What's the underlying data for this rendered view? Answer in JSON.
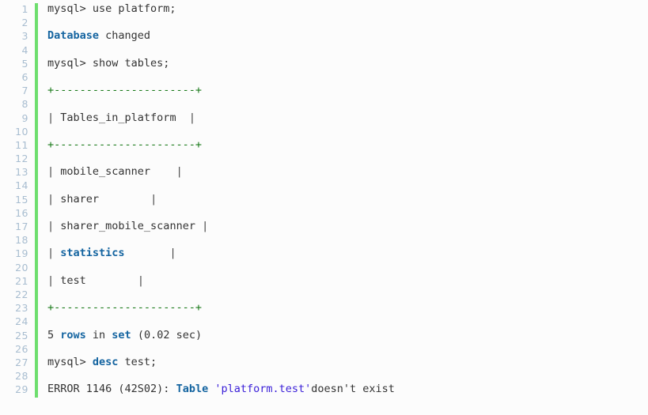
{
  "terminal": {
    "kind": "mysql-console-transcript",
    "background_color": "#fcfcfc",
    "gutter_bar_color": "#6ede6e",
    "line_number_color": "#a8bdd0",
    "colors": {
      "keyword": "#1464a0",
      "table_border": "#1a7a1a",
      "string_literal": "#3a1fd8",
      "plain_text": "#333333",
      "pipe": "#444444"
    },
    "line_numbers": [
      1,
      2,
      3,
      4,
      5,
      6,
      7,
      8,
      9,
      10,
      11,
      12,
      13,
      14,
      15,
      16,
      17,
      18,
      19,
      20,
      21,
      22,
      23,
      24,
      25,
      26,
      27,
      28,
      29
    ],
    "lines": [
      {
        "n": 1,
        "tokens": [
          {
            "t": "mysql> use platform;",
            "c": "plain"
          }
        ]
      },
      {
        "n": 2,
        "tokens": []
      },
      {
        "n": 3,
        "tokens": [
          {
            "t": "Database",
            "c": "kw"
          },
          {
            "t": " changed",
            "c": "plain"
          }
        ]
      },
      {
        "n": 4,
        "tokens": []
      },
      {
        "n": 5,
        "tokens": [
          {
            "t": "mysql> show tables;",
            "c": "plain"
          }
        ]
      },
      {
        "n": 6,
        "tokens": []
      },
      {
        "n": 7,
        "tokens": [
          {
            "t": "+----------------------+",
            "c": "border"
          }
        ]
      },
      {
        "n": 8,
        "tokens": []
      },
      {
        "n": 9,
        "tokens": [
          {
            "t": "|",
            "c": "pipe"
          },
          {
            "t": " Tables_in_platform  ",
            "c": "plain"
          },
          {
            "t": "|",
            "c": "pipe"
          }
        ]
      },
      {
        "n": 10,
        "tokens": []
      },
      {
        "n": 11,
        "tokens": [
          {
            "t": "+----------------------+",
            "c": "border"
          }
        ]
      },
      {
        "n": 12,
        "tokens": []
      },
      {
        "n": 13,
        "tokens": [
          {
            "t": "|",
            "c": "pipe"
          },
          {
            "t": " mobile_scanner    ",
            "c": "plain"
          },
          {
            "t": "|",
            "c": "pipe"
          }
        ]
      },
      {
        "n": 14,
        "tokens": []
      },
      {
        "n": 15,
        "tokens": [
          {
            "t": "|",
            "c": "pipe"
          },
          {
            "t": " sharer        ",
            "c": "plain"
          },
          {
            "t": "|",
            "c": "pipe"
          }
        ]
      },
      {
        "n": 16,
        "tokens": []
      },
      {
        "n": 17,
        "tokens": [
          {
            "t": "|",
            "c": "pipe"
          },
          {
            "t": " sharer_mobile_scanner ",
            "c": "plain"
          },
          {
            "t": "|",
            "c": "pipe"
          }
        ]
      },
      {
        "n": 18,
        "tokens": []
      },
      {
        "n": 19,
        "tokens": [
          {
            "t": "|",
            "c": "pipe"
          },
          {
            "t": " ",
            "c": "plain"
          },
          {
            "t": "statistics",
            "c": "kw"
          },
          {
            "t": "       ",
            "c": "plain"
          },
          {
            "t": "|",
            "c": "pipe"
          }
        ]
      },
      {
        "n": 20,
        "tokens": []
      },
      {
        "n": 21,
        "tokens": [
          {
            "t": "|",
            "c": "pipe"
          },
          {
            "t": " test        ",
            "c": "plain"
          },
          {
            "t": "|",
            "c": "pipe"
          }
        ]
      },
      {
        "n": 22,
        "tokens": []
      },
      {
        "n": 23,
        "tokens": [
          {
            "t": "+----------------------+",
            "c": "border"
          }
        ]
      },
      {
        "n": 24,
        "tokens": []
      },
      {
        "n": 25,
        "tokens": [
          {
            "t": "5 ",
            "c": "plain"
          },
          {
            "t": "rows",
            "c": "kw"
          },
          {
            "t": " in ",
            "c": "plain"
          },
          {
            "t": "set",
            "c": "kw"
          },
          {
            "t": " (0.02 sec)",
            "c": "plain"
          }
        ]
      },
      {
        "n": 26,
        "tokens": []
      },
      {
        "n": 27,
        "tokens": [
          {
            "t": "mysql> ",
            "c": "plain"
          },
          {
            "t": "desc",
            "c": "kw"
          },
          {
            "t": " test;",
            "c": "plain"
          }
        ]
      },
      {
        "n": 28,
        "tokens": []
      },
      {
        "n": 29,
        "tokens": [
          {
            "t": "ERROR 1146 (42S02): ",
            "c": "plain"
          },
          {
            "t": "Table",
            "c": "kw"
          },
          {
            "t": " ",
            "c": "plain"
          },
          {
            "t": "'platform.test'",
            "c": "str"
          },
          {
            "t": "doesn't exist",
            "c": "plain"
          }
        ]
      }
    ]
  }
}
